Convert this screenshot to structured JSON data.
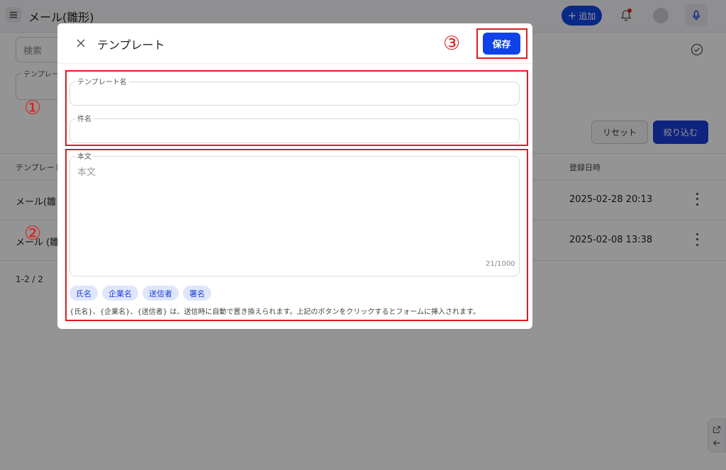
{
  "app": {
    "title": "メール(雛形)",
    "add_button": "追加",
    "search_placeholder": "検索",
    "template_select_label": "テンプレー",
    "reset_button": "リセット",
    "filter_button": "絞り込む",
    "table": {
      "headers": {
        "name": "テンプレート",
        "date": "登録日時"
      },
      "rows": [
        {
          "name": "メール(雛",
          "date": "2025-02-28 20:13"
        },
        {
          "name": "メール (雛",
          "date": "2025-02-08 13:38"
        }
      ]
    },
    "pager": "1-2 / 2",
    "colors": {
      "primary": "#1246e6",
      "notification": "#e02020"
    }
  },
  "modal": {
    "title": "テンプレート",
    "save_button": "保存",
    "fields": {
      "name_label": "テンプレート名",
      "subject_label": "件名",
      "body_label": "本文",
      "body_placeholder": "本文",
      "counter": "21/1000"
    },
    "chips": [
      "氏名",
      "企業名",
      "送信者",
      "署名"
    ],
    "note": "{氏名}、{企業名}、{送信者} は、送信時に自動で置き換えられます。上記のボタンをクリックするとフォームに挿入されます。"
  },
  "annotations": {
    "marker_1": "①",
    "marker_2": "②",
    "marker_3": "③",
    "color": "#e21b1b"
  }
}
